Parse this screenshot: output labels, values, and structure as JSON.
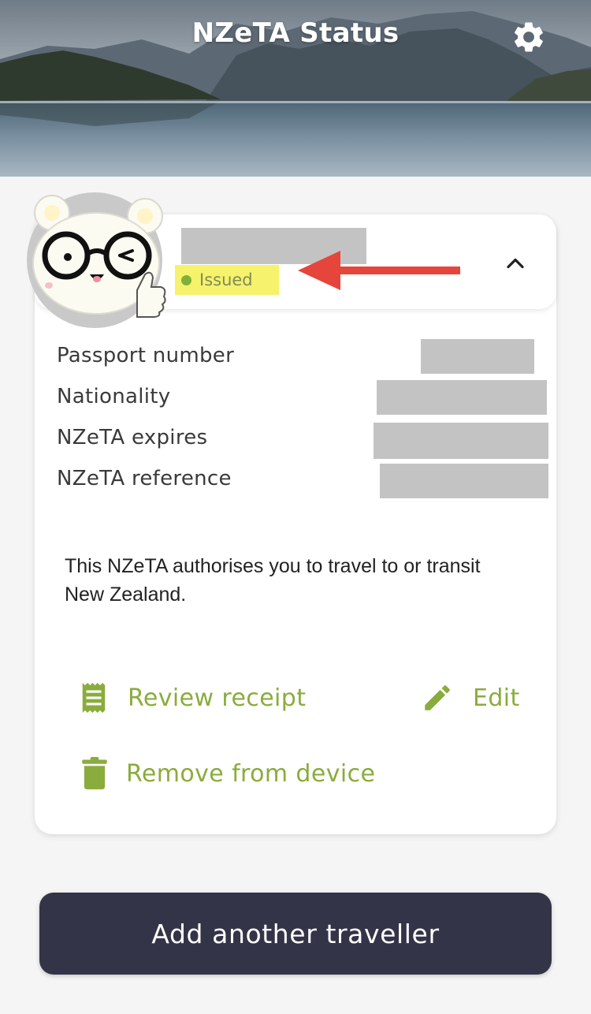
{
  "header": {
    "title": "NZeTA Status",
    "settings_icon": "gear-icon"
  },
  "traveller": {
    "status": "Issued",
    "status_color": "#7fb03a",
    "highlight_color": "#f6f26b",
    "annotation_arrow_color": "#e5453a",
    "details": [
      {
        "label": "Passport number"
      },
      {
        "label": "Nationality"
      },
      {
        "label": "NZeTA expires"
      },
      {
        "label": "NZeTA reference"
      }
    ],
    "note": "This NZeTA authorises you to travel to or transit New Zealand."
  },
  "actions": {
    "review_receipt": "Review receipt",
    "edit": "Edit",
    "remove": "Remove from device",
    "accent_color": "#8aac3c"
  },
  "add_button": {
    "label": "Add another traveller",
    "background": "#343448"
  }
}
